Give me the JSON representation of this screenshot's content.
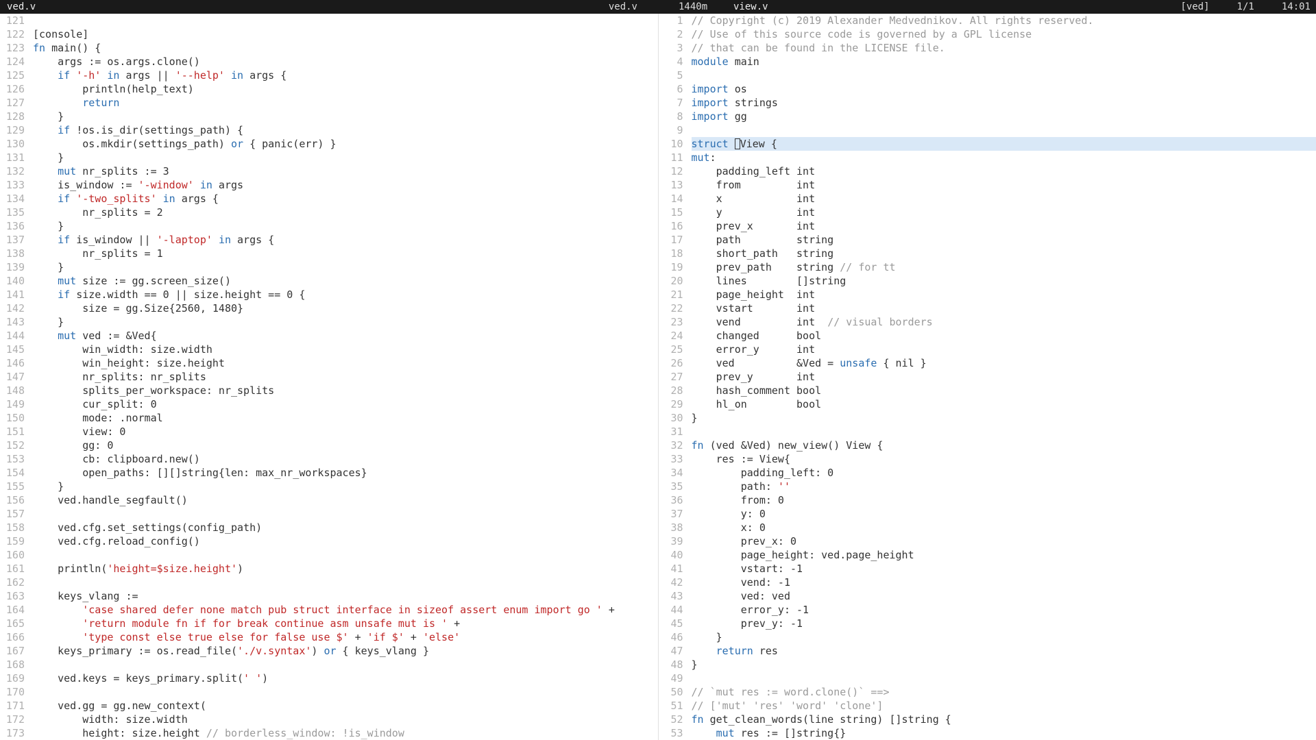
{
  "topbar": {
    "left_tab": "ved.v",
    "center_file": "ved.v",
    "center_meta": "1440m",
    "right_file": "view.v",
    "app": "[ved]",
    "pos": "1/1",
    "time": "14:01"
  },
  "left": {
    "start": 121,
    "lines": [
      [],
      [
        [
          "",
          "[console]"
        ]
      ],
      [
        [
          "kw",
          "fn"
        ],
        [
          "",
          " main() {"
        ]
      ],
      [
        [
          "",
          "    args := os.args.clone()"
        ]
      ],
      [
        [
          "",
          "    "
        ],
        [
          "kw",
          "if"
        ],
        [
          "",
          " "
        ],
        [
          "str",
          "'-h'"
        ],
        [
          "",
          " "
        ],
        [
          "kw",
          "in"
        ],
        [
          "",
          " args || "
        ],
        [
          "str",
          "'--help'"
        ],
        [
          "",
          " "
        ],
        [
          "kw",
          "in"
        ],
        [
          "",
          " args {"
        ]
      ],
      [
        [
          "",
          "        println(help_text)"
        ]
      ],
      [
        [
          "",
          "        "
        ],
        [
          "kw",
          "return"
        ]
      ],
      [
        [
          "",
          "    }"
        ]
      ],
      [
        [
          "",
          "    "
        ],
        [
          "kw",
          "if"
        ],
        [
          "",
          " !os.is_dir(settings_path) {"
        ]
      ],
      [
        [
          "",
          "        os.mkdir(settings_path) "
        ],
        [
          "kw",
          "or"
        ],
        [
          "",
          " { panic(err) }"
        ]
      ],
      [
        [
          "",
          "    }"
        ]
      ],
      [
        [
          "",
          "    "
        ],
        [
          "kw",
          "mut"
        ],
        [
          "",
          " nr_splits := 3"
        ]
      ],
      [
        [
          "",
          "    is_window := "
        ],
        [
          "str",
          "'-window'"
        ],
        [
          "",
          " "
        ],
        [
          "kw",
          "in"
        ],
        [
          "",
          " args"
        ]
      ],
      [
        [
          "",
          "    "
        ],
        [
          "kw",
          "if"
        ],
        [
          "",
          " "
        ],
        [
          "str",
          "'-two_splits'"
        ],
        [
          "",
          " "
        ],
        [
          "kw",
          "in"
        ],
        [
          "",
          " args {"
        ]
      ],
      [
        [
          "",
          "        nr_splits = 2"
        ]
      ],
      [
        [
          "",
          "    }"
        ]
      ],
      [
        [
          "",
          "    "
        ],
        [
          "kw",
          "if"
        ],
        [
          "",
          " is_window || "
        ],
        [
          "str",
          "'-laptop'"
        ],
        [
          "",
          " "
        ],
        [
          "kw",
          "in"
        ],
        [
          "",
          " args {"
        ]
      ],
      [
        [
          "",
          "        nr_splits = 1"
        ]
      ],
      [
        [
          "",
          "    }"
        ]
      ],
      [
        [
          "",
          "    "
        ],
        [
          "kw",
          "mut"
        ],
        [
          "",
          " size := gg.screen_size()"
        ]
      ],
      [
        [
          "",
          "    "
        ],
        [
          "kw",
          "if"
        ],
        [
          "",
          " size.width == 0 || size.height == 0 {"
        ]
      ],
      [
        [
          "",
          "        size = gg.Size{2560, 1480}"
        ]
      ],
      [
        [
          "",
          "    }"
        ]
      ],
      [
        [
          "",
          "    "
        ],
        [
          "kw",
          "mut"
        ],
        [
          "",
          " ved := &Ved{"
        ]
      ],
      [
        [
          "",
          "        win_width: size.width"
        ]
      ],
      [
        [
          "",
          "        win_height: size.height"
        ]
      ],
      [
        [
          "",
          "        nr_splits: nr_splits"
        ]
      ],
      [
        [
          "",
          "        splits_per_workspace: nr_splits"
        ]
      ],
      [
        [
          "",
          "        cur_split: 0"
        ]
      ],
      [
        [
          "",
          "        mode: .normal"
        ]
      ],
      [
        [
          "",
          "        view: 0"
        ]
      ],
      [
        [
          "",
          "        gg: 0"
        ]
      ],
      [
        [
          "",
          "        cb: clipboard.new()"
        ]
      ],
      [
        [
          "",
          "        open_paths: [][]string{len: max_nr_workspaces}"
        ]
      ],
      [
        [
          "",
          "    }"
        ]
      ],
      [
        [
          "",
          "    ved.handle_segfault()"
        ]
      ],
      [],
      [
        [
          "",
          "    ved.cfg.set_settings(config_path)"
        ]
      ],
      [
        [
          "",
          "    ved.cfg.reload_config()"
        ]
      ],
      [],
      [
        [
          "",
          "    println("
        ],
        [
          "str",
          "'height=$size.height'"
        ],
        [
          "",
          ")"
        ]
      ],
      [],
      [
        [
          "",
          "    keys_vlang :="
        ]
      ],
      [
        [
          "",
          "        "
        ],
        [
          "str",
          "'case shared defer none match pub struct interface in sizeof assert enum import go '"
        ],
        [
          "",
          " +"
        ]
      ],
      [
        [
          "",
          "        "
        ],
        [
          "str",
          "'return module fn if for break continue asm unsafe mut is '"
        ],
        [
          "",
          " +"
        ]
      ],
      [
        [
          "",
          "        "
        ],
        [
          "str",
          "'type const else true else for false use $'"
        ],
        [
          "",
          " + "
        ],
        [
          "str",
          "'if $'"
        ],
        [
          "",
          " + "
        ],
        [
          "str",
          "'else'"
        ]
      ],
      [
        [
          "",
          "    keys_primary := os.read_file("
        ],
        [
          "str",
          "'./v.syntax'"
        ],
        [
          "",
          ") "
        ],
        [
          "kw",
          "or"
        ],
        [
          "",
          " { keys_vlang }"
        ]
      ],
      [],
      [
        [
          "",
          "    ved.keys = keys_primary.split("
        ],
        [
          "str",
          "' '"
        ],
        [
          "",
          ")"
        ]
      ],
      [],
      [
        [
          "",
          "    ved.gg = gg.new_context("
        ]
      ],
      [
        [
          "",
          "        width: size.width"
        ]
      ],
      [
        [
          "",
          "        height: size.height "
        ],
        [
          "cmt",
          "// borderless_window: !is_window"
        ]
      ]
    ]
  },
  "right": {
    "start": 1,
    "highlight": 10,
    "lines": [
      [
        [
          "cmt",
          "// Copyright (c) 2019 Alexander Medvednikov. All rights reserved."
        ]
      ],
      [
        [
          "cmt",
          "// Use of this source code is governed by a GPL license"
        ]
      ],
      [
        [
          "cmt",
          "// that can be found in the LICENSE file."
        ]
      ],
      [
        [
          "kw",
          "module"
        ],
        [
          "",
          " main"
        ]
      ],
      [],
      [
        [
          "kw",
          "import"
        ],
        [
          "",
          " os"
        ]
      ],
      [
        [
          "kw",
          "import"
        ],
        [
          "",
          " strings"
        ]
      ],
      [
        [
          "kw",
          "import"
        ],
        [
          "",
          " gg"
        ]
      ],
      [],
      [
        [
          "kw",
          "struct"
        ],
        [
          "",
          " "
        ],
        [
          "cursor",
          ""
        ],
        [
          "",
          "View {"
        ]
      ],
      [
        [
          "kw",
          "mut"
        ],
        [
          "",
          ":"
        ]
      ],
      [
        [
          "",
          "    padding_left int"
        ]
      ],
      [
        [
          "",
          "    from         int"
        ]
      ],
      [
        [
          "",
          "    x            int"
        ]
      ],
      [
        [
          "",
          "    y            int"
        ]
      ],
      [
        [
          "",
          "    prev_x       int"
        ]
      ],
      [
        [
          "",
          "    path         string"
        ]
      ],
      [
        [
          "",
          "    short_path   string"
        ]
      ],
      [
        [
          "",
          "    prev_path    string "
        ],
        [
          "cmt",
          "// for tt"
        ]
      ],
      [
        [
          "",
          "    lines        []string"
        ]
      ],
      [
        [
          "",
          "    page_height  int"
        ]
      ],
      [
        [
          "",
          "    vstart       int"
        ]
      ],
      [
        [
          "",
          "    vend         int  "
        ],
        [
          "cmt",
          "// visual borders"
        ]
      ],
      [
        [
          "",
          "    changed      bool"
        ]
      ],
      [
        [
          "",
          "    error_y      int"
        ]
      ],
      [
        [
          "",
          "    ved          &Ved = "
        ],
        [
          "kw",
          "unsafe"
        ],
        [
          "",
          " { nil }"
        ]
      ],
      [
        [
          "",
          "    prev_y       int"
        ]
      ],
      [
        [
          "",
          "    hash_comment bool"
        ]
      ],
      [
        [
          "",
          "    hl_on        bool"
        ]
      ],
      [
        [
          "",
          "}"
        ]
      ],
      [],
      [
        [
          "kw",
          "fn"
        ],
        [
          "",
          " (ved &Ved) new_view() View {"
        ]
      ],
      [
        [
          "",
          "    res := View{"
        ]
      ],
      [
        [
          "",
          "        padding_left: 0"
        ]
      ],
      [
        [
          "",
          "        path: "
        ],
        [
          "str",
          "''"
        ]
      ],
      [
        [
          "",
          "        from: 0"
        ]
      ],
      [
        [
          "",
          "        y: 0"
        ]
      ],
      [
        [
          "",
          "        x: 0"
        ]
      ],
      [
        [
          "",
          "        prev_x: 0"
        ]
      ],
      [
        [
          "",
          "        page_height: ved.page_height"
        ]
      ],
      [
        [
          "",
          "        vstart: -1"
        ]
      ],
      [
        [
          "",
          "        vend: -1"
        ]
      ],
      [
        [
          "",
          "        ved: ved"
        ]
      ],
      [
        [
          "",
          "        error_y: -1"
        ]
      ],
      [
        [
          "",
          "        prev_y: -1"
        ]
      ],
      [
        [
          "",
          "    }"
        ]
      ],
      [
        [
          "",
          "    "
        ],
        [
          "kw",
          "return"
        ],
        [
          "",
          " res"
        ]
      ],
      [
        [
          "",
          "}"
        ]
      ],
      [],
      [
        [
          "cmt",
          "// `mut res := word.clone()` ==>"
        ]
      ],
      [
        [
          "cmt",
          "// ['mut' 'res' 'word' 'clone']"
        ]
      ],
      [
        [
          "kw",
          "fn"
        ],
        [
          "",
          " get_clean_words(line string) []string {"
        ]
      ],
      [
        [
          "",
          "    "
        ],
        [
          "kw",
          "mut"
        ],
        [
          "",
          " res := []string{}"
        ]
      ]
    ]
  }
}
